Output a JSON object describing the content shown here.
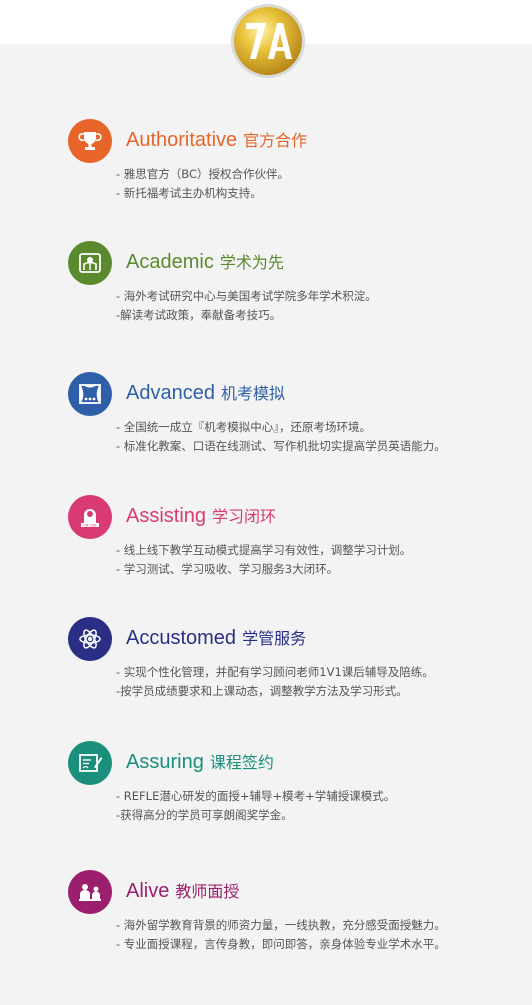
{
  "logo": {
    "text": "7A",
    "color": "#c9a227"
  },
  "features": [
    {
      "en": "Authoritative",
      "cn": "官方合作",
      "color": "#e8652a",
      "icon": "trophy-icon",
      "lines": [
        "- 雅思官方（BC）授权合作伙伴。",
        "- 新托福考试主办机构支持。"
      ]
    },
    {
      "en": "Academic",
      "cn": "学术为先",
      "color": "#5b8a2e",
      "icon": "book-icon",
      "lines": [
        "- 海外考试研究中心与美国考试学院多年学术积淀。",
        "-解读考试政策，奉献备考技巧。"
      ]
    },
    {
      "en": "Advanced",
      "cn": "机考模拟",
      "color": "#2e5fa8",
      "icon": "theater-icon",
      "lines": [
        "- 全国统一成立『机考模拟中心』，还原考场环境。",
        "- 标准化教案、口语在线测试、写作机批切实提高学员英语能力。"
      ]
    },
    {
      "en": "Assisting",
      "cn": "学习闭环",
      "color": "#d93a73",
      "icon": "online-teacher-icon",
      "lines": [
        "- 线上线下教学互动模式提高学习有效性，调整学习计划。",
        "- 学习测试、学习吸收、学习服务3大闭环。"
      ]
    },
    {
      "en": "Accustomed",
      "cn": "学管服务",
      "color": "#2a2f85",
      "icon": "atom-icon",
      "lines": [
        "- 实现个性化管理，并配有学习顾问老师1V1课后辅导及陪练。",
        "-按学员成绩要求和上课动态，调整教学方法及学习形式。"
      ]
    },
    {
      "en": "Assuring",
      "cn": "课程签约",
      "color": "#1a8f7c",
      "icon": "contract-icon",
      "lines": [
        "- REFLE潜心研发的面授+辅导+模考+学辅授课模式。",
        "-获得高分的学员可享朗阁奖学金。"
      ]
    },
    {
      "en": "Alive",
      "cn": "教师面授",
      "color": "#9c1f6e",
      "icon": "classroom-icon",
      "lines": [
        "- 海外留学教育背景的师资力量，一线执教，充分感受面授魅力。",
        "- 专业面授课程，言传身教，即问即答，亲身体验专业学术水平。"
      ]
    }
  ]
}
